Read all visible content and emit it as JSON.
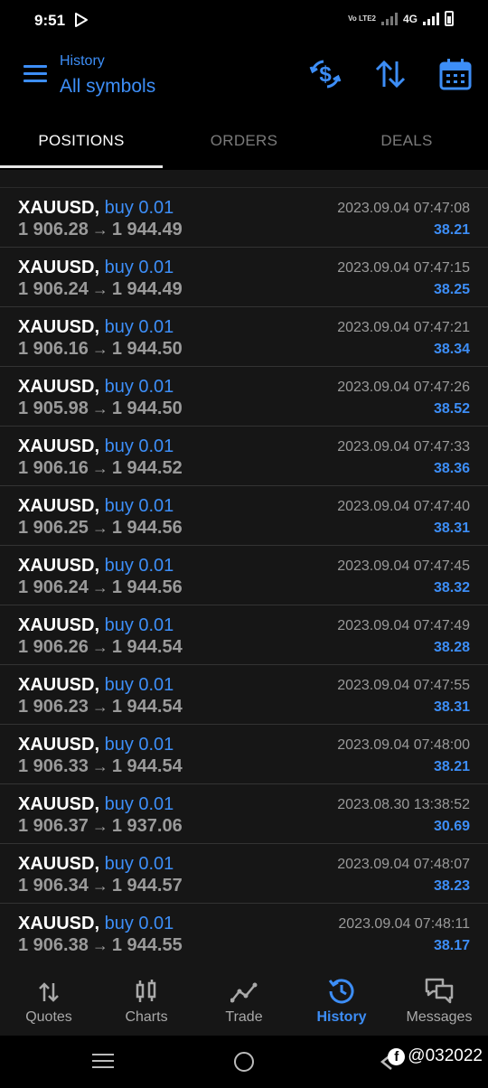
{
  "status_bar": {
    "time": "9:51",
    "network": "4G",
    "volte": "Vo LTE2"
  },
  "header": {
    "subtitle": "History",
    "title": "All symbols"
  },
  "tabs": [
    {
      "label": "POSITIONS",
      "active": true
    },
    {
      "label": "ORDERS",
      "active": false
    },
    {
      "label": "DEALS",
      "active": false
    }
  ],
  "positions": [
    {
      "symbol": "XAUUSD,",
      "side": "buy 0.01",
      "open": "1 906.28",
      "close": "1 944.49",
      "time": "2023.09.04 07:47:08",
      "profit": "38.21"
    },
    {
      "symbol": "XAUUSD,",
      "side": "buy 0.01",
      "open": "1 906.24",
      "close": "1 944.49",
      "time": "2023.09.04 07:47:15",
      "profit": "38.25"
    },
    {
      "symbol": "XAUUSD,",
      "side": "buy 0.01",
      "open": "1 906.16",
      "close": "1 944.50",
      "time": "2023.09.04 07:47:21",
      "profit": "38.34"
    },
    {
      "symbol": "XAUUSD,",
      "side": "buy 0.01",
      "open": "1 905.98",
      "close": "1 944.50",
      "time": "2023.09.04 07:47:26",
      "profit": "38.52"
    },
    {
      "symbol": "XAUUSD,",
      "side": "buy 0.01",
      "open": "1 906.16",
      "close": "1 944.52",
      "time": "2023.09.04 07:47:33",
      "profit": "38.36"
    },
    {
      "symbol": "XAUUSD,",
      "side": "buy 0.01",
      "open": "1 906.25",
      "close": "1 944.56",
      "time": "2023.09.04 07:47:40",
      "profit": "38.31"
    },
    {
      "symbol": "XAUUSD,",
      "side": "buy 0.01",
      "open": "1 906.24",
      "close": "1 944.56",
      "time": "2023.09.04 07:47:45",
      "profit": "38.32"
    },
    {
      "symbol": "XAUUSD,",
      "side": "buy 0.01",
      "open": "1 906.26",
      "close": "1 944.54",
      "time": "2023.09.04 07:47:49",
      "profit": "38.28"
    },
    {
      "symbol": "XAUUSD,",
      "side": "buy 0.01",
      "open": "1 906.23",
      "close": "1 944.54",
      "time": "2023.09.04 07:47:55",
      "profit": "38.31"
    },
    {
      "symbol": "XAUUSD,",
      "side": "buy 0.01",
      "open": "1 906.33",
      "close": "1 944.54",
      "time": "2023.09.04 07:48:00",
      "profit": "38.21"
    },
    {
      "symbol": "XAUUSD,",
      "side": "buy 0.01",
      "open": "1 906.37",
      "close": "1 937.06",
      "time": "2023.08.30 13:38:52",
      "profit": "30.69"
    },
    {
      "symbol": "XAUUSD,",
      "side": "buy 0.01",
      "open": "1 906.34",
      "close": "1 944.57",
      "time": "2023.09.04 07:48:07",
      "profit": "38.23"
    },
    {
      "symbol": "XAUUSD,",
      "side": "buy 0.01",
      "open": "1 906.38",
      "close": "1 944.55",
      "time": "2023.09.04 07:48:11",
      "profit": "38.17"
    }
  ],
  "bottom_nav": [
    {
      "label": "Quotes",
      "icon": "quotes-icon",
      "active": false
    },
    {
      "label": "Charts",
      "icon": "charts-icon",
      "active": false
    },
    {
      "label": "Trade",
      "icon": "trade-icon",
      "active": false
    },
    {
      "label": "History",
      "icon": "history-icon",
      "active": true
    },
    {
      "label": "Messages",
      "icon": "messages-icon",
      "active": false
    }
  ],
  "watermark": "@032022",
  "colors": {
    "accent": "#3d8ef7",
    "background": "#000000",
    "list_bg": "#161616",
    "muted": "#9a9a9a"
  }
}
